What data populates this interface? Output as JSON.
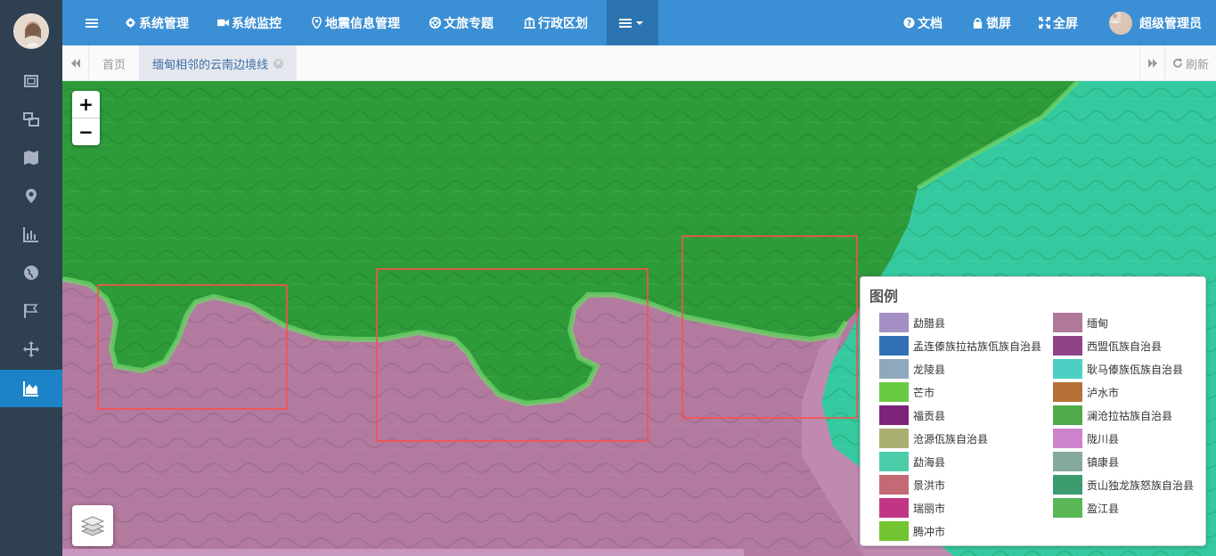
{
  "topnav": {
    "items": [
      {
        "label": "系统管理",
        "icon": "gear-icon"
      },
      {
        "label": "系统监控",
        "icon": "video-camera-icon"
      },
      {
        "label": "地震信息管理",
        "icon": "map-marker-icon"
      },
      {
        "label": "文旅专题",
        "icon": "life-ring-icon"
      },
      {
        "label": "行政区划",
        "icon": "institution-icon"
      }
    ],
    "right": [
      {
        "label": "文档",
        "icon": "question-circle-icon"
      },
      {
        "label": "锁屏",
        "icon": "lock-icon"
      },
      {
        "label": "全屏",
        "icon": "expand-icon"
      }
    ],
    "user": "超级管理员"
  },
  "tabs": {
    "home": "首页",
    "active": "缅甸相邻的云南边境线",
    "refresh": "刷新"
  },
  "sidebar": {
    "items": [
      "screenshot-icon",
      "object-group-icon",
      "map-icon",
      "map-marker-icon",
      "bar-chart-icon",
      "globe-icon",
      "flag-icon",
      "arrows-icon",
      "area-chart-icon"
    ],
    "active_index": 8
  },
  "map": {
    "zoom_in": "+",
    "zoom_out": "−",
    "colors": {
      "myanmar": "#b27a9e",
      "green_region": "#2e9b3a",
      "teal_region": "#35c9a0",
      "selection_box": "#ff4d4d"
    }
  },
  "legend": {
    "title": "图例",
    "items": [
      {
        "label": "勐腊县",
        "color": "#c0a8e6"
      },
      {
        "label": "缅甸",
        "color": "#cf8db5"
      },
      {
        "label": "孟连傣族拉祜族佤族自治县",
        "color": "#3b84d6"
      },
      {
        "label": "西盟佤族自治县",
        "color": "#a84f9e"
      },
      {
        "label": "龙陵县",
        "color": "#a9c6dc"
      },
      {
        "label": "耿马傣族佤族自治县",
        "color": "#5bf5e6"
      },
      {
        "label": "芒市",
        "color": "#7bef4e"
      },
      {
        "label": "泸水市",
        "color": "#d6843e"
      },
      {
        "label": "福贡县",
        "color": "#93298e"
      },
      {
        "label": "澜沧拉祜族自治县",
        "color": "#5dc85a"
      },
      {
        "label": "沧源佤族自治县",
        "color": "#c9cf86"
      },
      {
        "label": "陇川县",
        "color": "#f19af0"
      },
      {
        "label": "勐海县",
        "color": "#5bf0c8"
      },
      {
        "label": "镇康县",
        "color": "#9dc7b8"
      },
      {
        "label": "景洪市",
        "color": "#e57d8a"
      },
      {
        "label": "贡山独龙族怒族自治县",
        "color": "#47b884"
      },
      {
        "label": "瑞丽市",
        "color": "#e43e9c"
      },
      {
        "label": "盈江县",
        "color": "#6ad765"
      },
      {
        "label": "腾冲市",
        "color": "#86e83a"
      }
    ]
  }
}
